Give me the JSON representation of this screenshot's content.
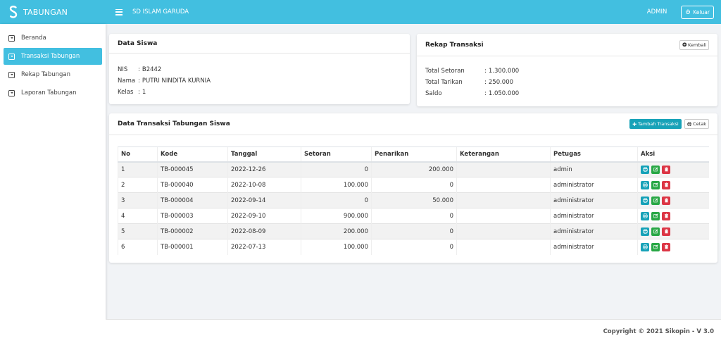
{
  "brand": {
    "name": "TABUNGAN"
  },
  "header": {
    "school": "SD ISLAM GARUDA",
    "user": "ADMIN",
    "logout_label": "Keluar"
  },
  "sidebar": {
    "items": [
      {
        "label": "Beranda",
        "active": false
      },
      {
        "label": "Transaksi Tabungan",
        "active": true
      },
      {
        "label": "Rekap Tabungan",
        "active": false
      },
      {
        "label": "Laporan Tabungan",
        "active": false
      }
    ]
  },
  "student": {
    "title": "Data Siswa",
    "nis_label": "NIS",
    "nis": "B2442",
    "nama_label": "Nama",
    "nama": "PUTRI NINDITA KURNIA",
    "kelas_label": "Kelas",
    "kelas": "1"
  },
  "rekap": {
    "title": "Rekap Transaksi",
    "back_label": "Kembali",
    "setoran_label": "Total Setoran",
    "setoran": "1.300.000",
    "tarikan_label": "Total Tarikan",
    "tarikan": "250.000",
    "saldo_label": "Saldo",
    "saldo": "1.050.000"
  },
  "transactions": {
    "title": "Data Transaksi Tabungan Siswa",
    "add_label": "Tambah Transaksi",
    "print_label": "Cetak",
    "columns": [
      "No",
      "Kode",
      "Tanggal",
      "Setoran",
      "Penarikan",
      "Keterangan",
      "Petugas",
      "Aksi"
    ],
    "rows": [
      {
        "no": "1",
        "kode": "TB-000045",
        "tanggal": "2022-12-26",
        "setoran": "0",
        "penarikan": "200.000",
        "keterangan": "",
        "petugas": "admin"
      },
      {
        "no": "2",
        "kode": "TB-000040",
        "tanggal": "2022-10-08",
        "setoran": "100.000",
        "penarikan": "0",
        "keterangan": "",
        "petugas": "administrator"
      },
      {
        "no": "3",
        "kode": "TB-000004",
        "tanggal": "2022-09-14",
        "setoran": "0",
        "penarikan": "50.000",
        "keterangan": "",
        "petugas": "administrator"
      },
      {
        "no": "4",
        "kode": "TB-000003",
        "tanggal": "2022-09-10",
        "setoran": "900.000",
        "penarikan": "0",
        "keterangan": "",
        "petugas": "administrator"
      },
      {
        "no": "5",
        "kode": "TB-000002",
        "tanggal": "2022-08-09",
        "setoran": "200.000",
        "penarikan": "0",
        "keterangan": "",
        "petugas": "administrator"
      },
      {
        "no": "6",
        "kode": "TB-000001",
        "tanggal": "2022-07-13",
        "setoran": "100.000",
        "penarikan": "0",
        "keterangan": "",
        "petugas": "administrator"
      }
    ]
  },
  "footer": {
    "text": "Copyright © 2021 Sikopin - V 3.0"
  },
  "colors": {
    "primary": "#42bfe0",
    "info": "#17a2b8",
    "success": "#28a745",
    "danger": "#dc3545"
  },
  "icons": {
    "logo": "s-logo-icon",
    "menu": "hamburger-icon",
    "logout": "power-icon",
    "nav": "caret-box-icon",
    "back": "arrow-left-circle-icon",
    "add": "plus-icon",
    "print": "printer-icon",
    "edit": "edit-icon",
    "delete": "trash-icon"
  }
}
